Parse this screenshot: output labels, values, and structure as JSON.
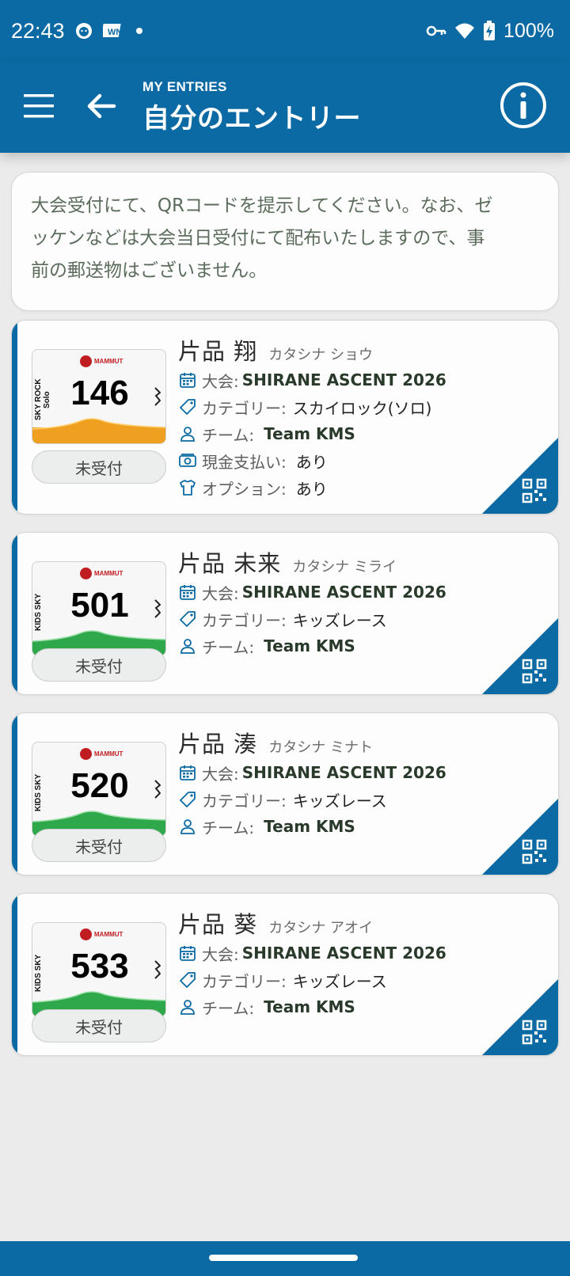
{
  "status_bar": {
    "time": "22:43",
    "battery": "100%",
    "icons": [
      "face-icon",
      "wn-icon",
      "dot-icon",
      "key-icon",
      "wifi-icon",
      "battery-charging-icon"
    ]
  },
  "app_bar": {
    "subtitle": "MY ENTRIES",
    "title": "自分のエントリー",
    "icons": [
      "menu-icon",
      "back-arrow-icon",
      "info-icon"
    ],
    "color": "#0b6aa3"
  },
  "notice": {
    "line1": "大会受付にて、QRコードを提示してください。なお、ゼ",
    "line2": "ッケンなどは大会当日受付にて配布いたしますので、事",
    "line3": "前の郵送物はございません。"
  },
  "labels": {
    "event": "大会:",
    "category": "カテゴリー:",
    "team": "チーム:",
    "cash": "現金支払い:",
    "option": "オプション:"
  },
  "entries": [
    {
      "name": "片品 翔",
      "kana": "カタシナ ショウ",
      "event": "SHIRANE ASCENT 2026",
      "category": "スカイロック(ソロ)",
      "team": "Team KMS",
      "cash": "あり",
      "option": "あり",
      "status": "未受付",
      "bib": {
        "number": "146",
        "side": "SKY ROCK Solo",
        "logo": "MAMMUT",
        "band_color": "#f0a020"
      }
    },
    {
      "name": "片品 未来",
      "kana": "カタシナ ミライ",
      "event": "SHIRANE ASCENT 2026",
      "category": "キッズレース",
      "team": "Team KMS",
      "status": "未受付",
      "bib": {
        "number": "501",
        "side": "KIDS SKY",
        "logo": "MAMMUT",
        "band_color": "#2ea84a"
      }
    },
    {
      "name": "片品 湊",
      "kana": "カタシナ ミナト",
      "event": "SHIRANE ASCENT 2026",
      "category": "キッズレース",
      "team": "Team KMS",
      "status": "未受付",
      "bib": {
        "number": "520",
        "side": "KIDS SKY",
        "logo": "MAMMUT",
        "band_color": "#2ea84a"
      }
    },
    {
      "name": "片品 葵",
      "kana": "カタシナ アオイ",
      "event": "SHIRANE ASCENT 2026",
      "category": "キッズレース",
      "team": "Team KMS",
      "status": "未受付",
      "bib": {
        "number": "533",
        "side": "KIDS SKY",
        "logo": "MAMMUT",
        "band_color": "#2ea84a"
      }
    }
  ]
}
